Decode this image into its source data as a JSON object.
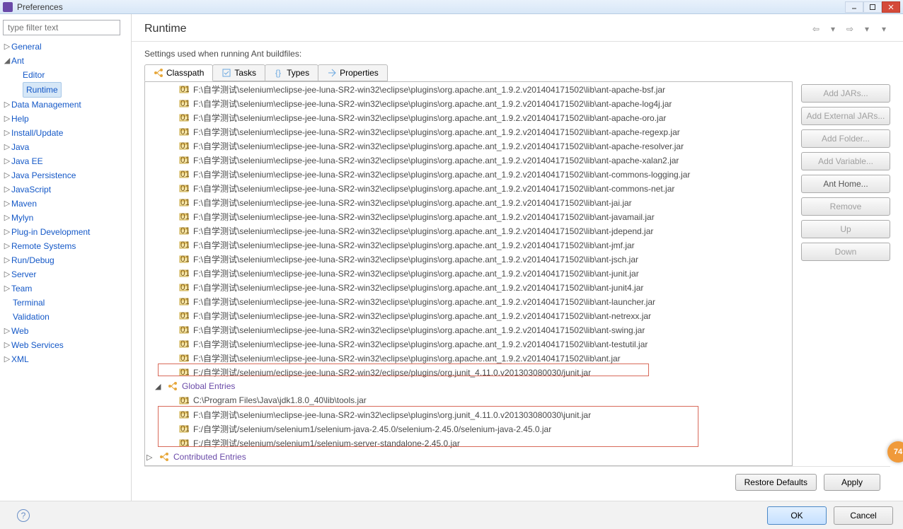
{
  "window": {
    "title": "Preferences"
  },
  "filter_placeholder": "type filter text",
  "tree": {
    "general": "General",
    "ant": "Ant",
    "editor": "Editor",
    "runtime": "Runtime",
    "data_management": "Data Management",
    "help": "Help",
    "install_update": "Install/Update",
    "java": "Java",
    "java_ee": "Java EE",
    "java_persistence": "Java Persistence",
    "javascript": "JavaScript",
    "maven": "Maven",
    "mylyn": "Mylyn",
    "plugin_dev": "Plug-in Development",
    "remote_systems": "Remote Systems",
    "run_debug": "Run/Debug",
    "server": "Server",
    "team": "Team",
    "terminal": "Terminal",
    "validation": "Validation",
    "web": "Web",
    "web_services": "Web Services",
    "xml": "XML"
  },
  "page": {
    "title": "Runtime",
    "desc": "Settings used when running Ant buildfiles:"
  },
  "tabs": {
    "classpath": "Classpath",
    "tasks": "Tasks",
    "types": "Types",
    "properties": "Properties"
  },
  "classpath": {
    "jars": [
      "F:\\自学测试\\selenium\\eclipse-jee-luna-SR2-win32\\eclipse\\plugins\\org.apache.ant_1.9.2.v201404171502\\lib\\ant-apache-bsf.jar",
      "F:\\自学测试\\selenium\\eclipse-jee-luna-SR2-win32\\eclipse\\plugins\\org.apache.ant_1.9.2.v201404171502\\lib\\ant-apache-log4j.jar",
      "F:\\自学测试\\selenium\\eclipse-jee-luna-SR2-win32\\eclipse\\plugins\\org.apache.ant_1.9.2.v201404171502\\lib\\ant-apache-oro.jar",
      "F:\\自学测试\\selenium\\eclipse-jee-luna-SR2-win32\\eclipse\\plugins\\org.apache.ant_1.9.2.v201404171502\\lib\\ant-apache-regexp.jar",
      "F:\\自学测试\\selenium\\eclipse-jee-luna-SR2-win32\\eclipse\\plugins\\org.apache.ant_1.9.2.v201404171502\\lib\\ant-apache-resolver.jar",
      "F:\\自学测试\\selenium\\eclipse-jee-luna-SR2-win32\\eclipse\\plugins\\org.apache.ant_1.9.2.v201404171502\\lib\\ant-apache-xalan2.jar",
      "F:\\自学测试\\selenium\\eclipse-jee-luna-SR2-win32\\eclipse\\plugins\\org.apache.ant_1.9.2.v201404171502\\lib\\ant-commons-logging.jar",
      "F:\\自学测试\\selenium\\eclipse-jee-luna-SR2-win32\\eclipse\\plugins\\org.apache.ant_1.9.2.v201404171502\\lib\\ant-commons-net.jar",
      "F:\\自学测试\\selenium\\eclipse-jee-luna-SR2-win32\\eclipse\\plugins\\org.apache.ant_1.9.2.v201404171502\\lib\\ant-jai.jar",
      "F:\\自学测试\\selenium\\eclipse-jee-luna-SR2-win32\\eclipse\\plugins\\org.apache.ant_1.9.2.v201404171502\\lib\\ant-javamail.jar",
      "F:\\自学测试\\selenium\\eclipse-jee-luna-SR2-win32\\eclipse\\plugins\\org.apache.ant_1.9.2.v201404171502\\lib\\ant-jdepend.jar",
      "F:\\自学测试\\selenium\\eclipse-jee-luna-SR2-win32\\eclipse\\plugins\\org.apache.ant_1.9.2.v201404171502\\lib\\ant-jmf.jar",
      "F:\\自学测试\\selenium\\eclipse-jee-luna-SR2-win32\\eclipse\\plugins\\org.apache.ant_1.9.2.v201404171502\\lib\\ant-jsch.jar",
      "F:\\自学测试\\selenium\\eclipse-jee-luna-SR2-win32\\eclipse\\plugins\\org.apache.ant_1.9.2.v201404171502\\lib\\ant-junit.jar",
      "F:\\自学测试\\selenium\\eclipse-jee-luna-SR2-win32\\eclipse\\plugins\\org.apache.ant_1.9.2.v201404171502\\lib\\ant-junit4.jar",
      "F:\\自学测试\\selenium\\eclipse-jee-luna-SR2-win32\\eclipse\\plugins\\org.apache.ant_1.9.2.v201404171502\\lib\\ant-launcher.jar",
      "F:\\自学测试\\selenium\\eclipse-jee-luna-SR2-win32\\eclipse\\plugins\\org.apache.ant_1.9.2.v201404171502\\lib\\ant-netrexx.jar",
      "F:\\自学测试\\selenium\\eclipse-jee-luna-SR2-win32\\eclipse\\plugins\\org.apache.ant_1.9.2.v201404171502\\lib\\ant-swing.jar",
      "F:\\自学测试\\selenium\\eclipse-jee-luna-SR2-win32\\eclipse\\plugins\\org.apache.ant_1.9.2.v201404171502\\lib\\ant-testutil.jar",
      "F:\\自学测试\\selenium\\eclipse-jee-luna-SR2-win32\\eclipse\\plugins\\org.apache.ant_1.9.2.v201404171502\\lib\\ant.jar",
      "F:/自学测试/selenium/eclipse-jee-luna-SR2-win32/eclipse/plugins/org.junit_4.11.0.v201303080030/junit.jar"
    ],
    "global_label": "Global Entries",
    "global": [
      "C:\\Program Files\\Java\\jdk1.8.0_40\\lib\\tools.jar",
      "F:\\自学测试\\selenium\\eclipse-jee-luna-SR2-win32\\eclipse\\plugins\\org.junit_4.11.0.v201303080030\\junit.jar",
      "F:/自学测试/selenium/selenium1/selenium-java-2.45.0/selenium-2.45.0/selenium-java-2.45.0.jar",
      "F:/自学测试/selenium/selenium1/selenium-server-standalone-2.45.0.jar"
    ],
    "contrib_label": "Contributed Entries"
  },
  "sidebtns": {
    "add_jars": "Add JARs...",
    "add_external": "Add External JARs...",
    "add_folder": "Add Folder...",
    "add_variable": "Add Variable...",
    "ant_home": "Ant Home...",
    "remove": "Remove",
    "up": "Up",
    "down": "Down"
  },
  "bottom": {
    "restore": "Restore Defaults",
    "apply": "Apply"
  },
  "footer": {
    "ok": "OK",
    "cancel": "Cancel"
  },
  "watermark": "74"
}
